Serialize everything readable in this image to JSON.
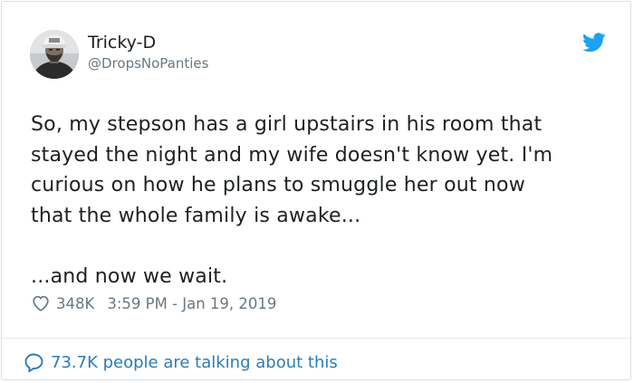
{
  "user": {
    "display_name": "Tricky-D",
    "handle": "@DropsNoPanties",
    "avatar_icon": "profile-avatar"
  },
  "brand": {
    "icon": "twitter-bird-icon",
    "color": "#1da1f2"
  },
  "tweet": {
    "lines": [
      "So, my stepson has a girl upstairs in his room that",
      "stayed the night and my wife doesn't know yet. I'm",
      "curious on how he plans to smuggle her out now",
      "that the whole family is awake..."
    ],
    "closing": "...and now we wait."
  },
  "meta": {
    "like_icon": "heart-icon",
    "likes": "348K",
    "timestamp": "3:59 PM - Jan 19, 2019"
  },
  "footer": {
    "icon": "speech-bubble-icon",
    "talking_text": "73.7K people are talking about this",
    "link_color": "#2b7bb9"
  }
}
